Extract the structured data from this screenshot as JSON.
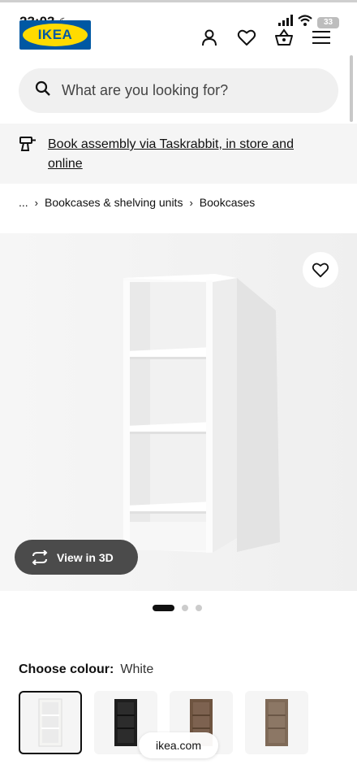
{
  "status_bar": {
    "time": "23:03",
    "battery": "33"
  },
  "header": {
    "logo_text": "IKEA"
  },
  "search": {
    "placeholder": "What are you looking for?"
  },
  "banner": {
    "link_text": "Book assembly via Taskrabbit, in store and online"
  },
  "breadcrumb": {
    "ellipsis": "...",
    "items": [
      "Bookcases & shelving units",
      "Bookcases"
    ]
  },
  "gallery": {
    "view_3d_label": "View in 3D",
    "pages": 3,
    "active_page": 1
  },
  "colour": {
    "label": "Choose colour:",
    "value": "White",
    "swatches": [
      {
        "name": "white",
        "color": "#f4f4f2",
        "selected": true
      },
      {
        "name": "black-brown",
        "color": "#1e1e1e",
        "selected": false
      },
      {
        "name": "dark-brown",
        "color": "#6e5440",
        "selected": false
      },
      {
        "name": "brown-walnut",
        "color": "#7f6a58",
        "selected": false
      }
    ]
  },
  "browser": {
    "domain": "ikea.com"
  },
  "colors": {
    "brand_blue": "#0058a3",
    "brand_yellow": "#ffdb00"
  }
}
